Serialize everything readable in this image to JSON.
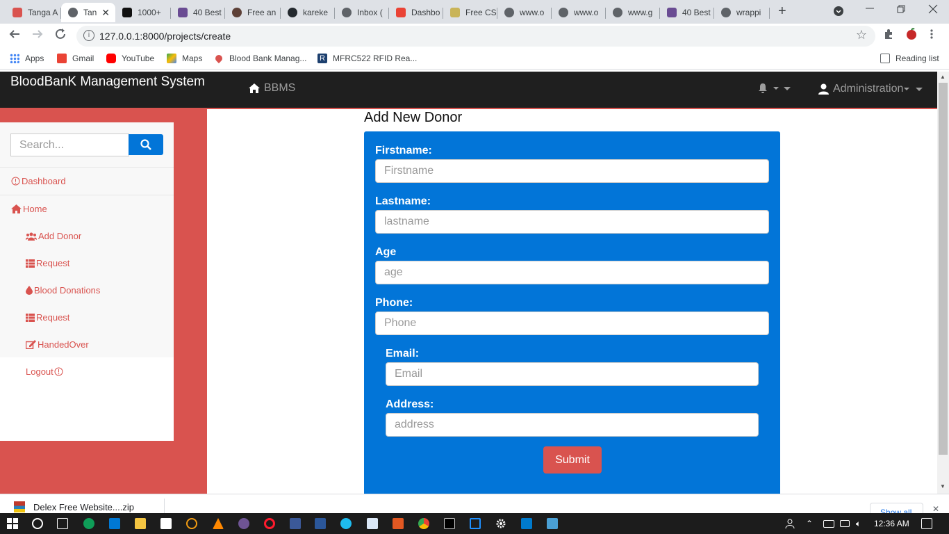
{
  "browser": {
    "tabs": [
      {
        "title": "Tanga A",
        "active": false
      },
      {
        "title": "Tan",
        "active": true
      },
      {
        "title": "1000+",
        "active": false
      },
      {
        "title": "40 Best",
        "active": false
      },
      {
        "title": "Free an",
        "active": false
      },
      {
        "title": "kareke",
        "active": false
      },
      {
        "title": "Inbox (",
        "active": false
      },
      {
        "title": "Dashbo",
        "active": false
      },
      {
        "title": "Free CS",
        "active": false
      },
      {
        "title": "www.o",
        "active": false
      },
      {
        "title": "www.o",
        "active": false
      },
      {
        "title": "www.g",
        "active": false
      },
      {
        "title": "40 Best",
        "active": false
      },
      {
        "title": "wrappi",
        "active": false
      }
    ],
    "url": "127.0.0.1:8000/projects/create",
    "bookmarks": [
      "Apps",
      "Gmail",
      "YouTube",
      "Maps",
      "Blood Bank Manag...",
      "MFRC522 RFID Rea..."
    ],
    "reading_list": "Reading list",
    "new_tab_symbol": "+",
    "close_tab_symbol": "✕"
  },
  "app": {
    "brand": "BloodBanK Management System",
    "nav_link": "BBMS",
    "admin_label": "Administration"
  },
  "sidebar": {
    "search_placeholder": "Search...",
    "items": [
      {
        "label": "Dashboard",
        "icon": "info-icon"
      },
      {
        "label": "Home",
        "icon": "home-icon"
      },
      {
        "label": "Add Donor",
        "icon": "users-icon"
      },
      {
        "label": "Request",
        "icon": "table-icon"
      },
      {
        "label": "Blood Donations",
        "icon": "drop-icon"
      },
      {
        "label": "Request",
        "icon": "table-icon"
      },
      {
        "label": "HandedOver",
        "icon": "edit-icon"
      },
      {
        "label": "Logout",
        "icon": "info-icon"
      }
    ]
  },
  "form": {
    "title": "Add New Donor",
    "fields": [
      {
        "label": "Firstname:",
        "placeholder": "Firstname"
      },
      {
        "label": "Lastname:",
        "placeholder": "lastname"
      },
      {
        "label": "Age",
        "placeholder": "age"
      },
      {
        "label": "Phone:",
        "placeholder": "Phone"
      },
      {
        "label": "Email:",
        "placeholder": "Email"
      },
      {
        "label": "Address:",
        "placeholder": "address"
      }
    ],
    "submit_label": "Submit"
  },
  "download_bar": {
    "file": "Delex Free Website....zip",
    "show_all": "Show all"
  },
  "taskbar": {
    "time": "12:36 AM"
  },
  "colors": {
    "navbar": "#1f1f1f",
    "accent_red": "#d9534f",
    "panel_blue": "#0275d8"
  }
}
